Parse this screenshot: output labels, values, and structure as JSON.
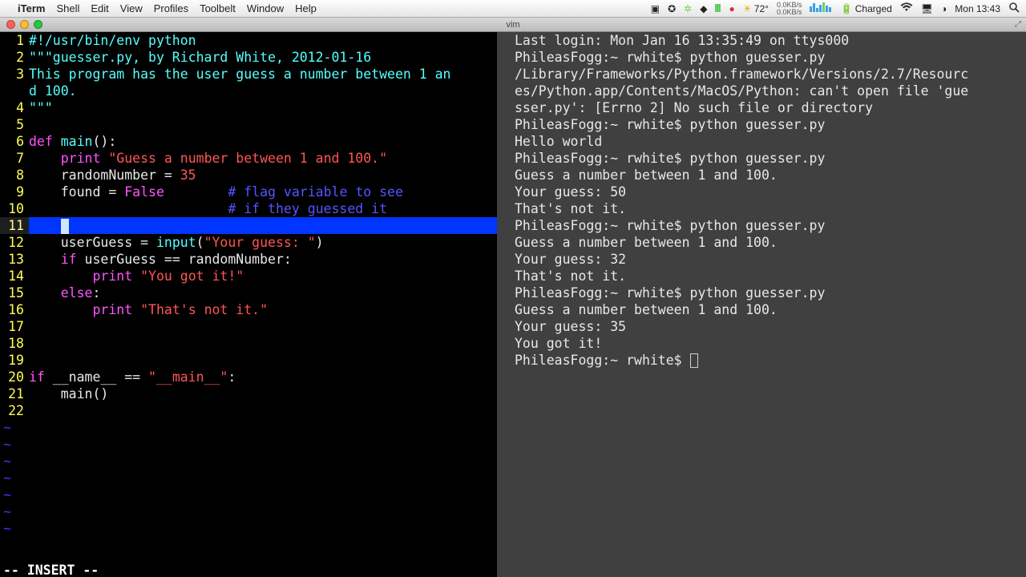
{
  "menubar": {
    "app": "iTerm",
    "items": [
      "Shell",
      "Edit",
      "View",
      "Profiles",
      "Toolbelt",
      "Window",
      "Help"
    ],
    "temp": "72°",
    "net_up": "0.0KB/s",
    "net_dn": "0.0KB/s",
    "battery": "Charged",
    "clock": "Mon 13:43"
  },
  "window": {
    "title": "vim"
  },
  "vim": {
    "mode": "-- INSERT --",
    "cursor_line": 11,
    "lines": [
      {
        "n": 1,
        "seg": [
          {
            "t": "#!/usr/bin/env python",
            "c": "c-doc"
          }
        ]
      },
      {
        "n": 2,
        "seg": [
          {
            "t": "\"\"\"guesser.py, by Richard White, 2012-01-16",
            "c": "c-doc"
          }
        ]
      },
      {
        "n": 3,
        "seg": [
          {
            "t": "This program has the user guess a number between 1 an",
            "c": "c-doc"
          }
        ]
      },
      {
        "n": 0,
        "seg": [
          {
            "t": "d 100.",
            "c": "c-doc"
          }
        ]
      },
      {
        "n": 4,
        "seg": [
          {
            "t": "\"\"\"",
            "c": "c-doc"
          }
        ]
      },
      {
        "n": 5,
        "seg": [
          {
            "t": "",
            "c": ""
          }
        ]
      },
      {
        "n": 6,
        "seg": [
          {
            "t": "def ",
            "c": "c-kw"
          },
          {
            "t": "main",
            "c": "c-def"
          },
          {
            "t": "():",
            "c": ""
          }
        ]
      },
      {
        "n": 7,
        "seg": [
          {
            "t": "    ",
            "c": ""
          },
          {
            "t": "print",
            "c": "c-kw"
          },
          {
            "t": " ",
            "c": ""
          },
          {
            "t": "\"Guess a number between 1 and 100.\"",
            "c": "c-str"
          }
        ]
      },
      {
        "n": 8,
        "seg": [
          {
            "t": "    randomNumber = ",
            "c": ""
          },
          {
            "t": "35",
            "c": "c-lit"
          }
        ]
      },
      {
        "n": 9,
        "seg": [
          {
            "t": "    found = ",
            "c": ""
          },
          {
            "t": "False",
            "c": "c-bool"
          },
          {
            "t": "        ",
            "c": ""
          },
          {
            "t": "# flag variable to see",
            "c": "c-cmt"
          }
        ]
      },
      {
        "n": 10,
        "seg": [
          {
            "t": "                         ",
            "c": ""
          },
          {
            "t": "# if they guessed it",
            "c": "c-cmt"
          }
        ]
      },
      {
        "n": 11,
        "cursor": true,
        "seg": [
          {
            "t": "    ",
            "c": ""
          }
        ]
      },
      {
        "n": 12,
        "seg": [
          {
            "t": "    userGuess = ",
            "c": ""
          },
          {
            "t": "input",
            "c": "c-def"
          },
          {
            "t": "(",
            "c": ""
          },
          {
            "t": "\"Your guess: \"",
            "c": "c-str"
          },
          {
            "t": ")",
            "c": ""
          }
        ]
      },
      {
        "n": 13,
        "seg": [
          {
            "t": "    ",
            "c": ""
          },
          {
            "t": "if",
            "c": "c-kw"
          },
          {
            "t": " userGuess == randomNumber:",
            "c": ""
          }
        ]
      },
      {
        "n": 14,
        "seg": [
          {
            "t": "        ",
            "c": ""
          },
          {
            "t": "print",
            "c": "c-kw"
          },
          {
            "t": " ",
            "c": ""
          },
          {
            "t": "\"You got it!\"",
            "c": "c-str"
          }
        ]
      },
      {
        "n": 15,
        "seg": [
          {
            "t": "    ",
            "c": ""
          },
          {
            "t": "else",
            "c": "c-kw"
          },
          {
            "t": ":",
            "c": ""
          }
        ]
      },
      {
        "n": 16,
        "seg": [
          {
            "t": "        ",
            "c": ""
          },
          {
            "t": "print",
            "c": "c-kw"
          },
          {
            "t": " ",
            "c": ""
          },
          {
            "t": "\"That's not it.\"",
            "c": "c-str"
          }
        ]
      },
      {
        "n": 17,
        "seg": [
          {
            "t": "",
            "c": ""
          }
        ]
      },
      {
        "n": 18,
        "seg": [
          {
            "t": "",
            "c": ""
          }
        ]
      },
      {
        "n": 19,
        "seg": [
          {
            "t": "",
            "c": ""
          }
        ]
      },
      {
        "n": 20,
        "seg": [
          {
            "t": "if",
            "c": "c-kw"
          },
          {
            "t": " __name__ == ",
            "c": ""
          },
          {
            "t": "\"__main__\"",
            "c": "c-str"
          },
          {
            "t": ":",
            "c": ""
          }
        ]
      },
      {
        "n": 21,
        "seg": [
          {
            "t": "    main()",
            "c": ""
          }
        ]
      },
      {
        "n": 22,
        "seg": [
          {
            "t": "",
            "c": ""
          }
        ]
      }
    ],
    "tildes": 7
  },
  "shell": {
    "lines": [
      "Last login: Mon Jan 16 13:35:49 on ttys000",
      "PhileasFogg:~ rwhite$ python guesser.py",
      "/Library/Frameworks/Python.framework/Versions/2.7/Resourc",
      "es/Python.app/Contents/MacOS/Python: can't open file 'gue",
      "sser.py': [Errno 2] No such file or directory",
      "PhileasFogg:~ rwhite$ python guesser.py",
      "Hello world",
      "PhileasFogg:~ rwhite$ python guesser.py",
      "Guess a number between 1 and 100.",
      "Your guess: 50",
      "That's not it.",
      "PhileasFogg:~ rwhite$ python guesser.py",
      "Guess a number between 1 and 100.",
      "Your guess: 32",
      "That's not it.",
      "PhileasFogg:~ rwhite$ python guesser.py",
      "Guess a number between 1 and 100.",
      "Your guess: 35",
      "You got it!"
    ],
    "prompt": "PhileasFogg:~ rwhite$ "
  }
}
